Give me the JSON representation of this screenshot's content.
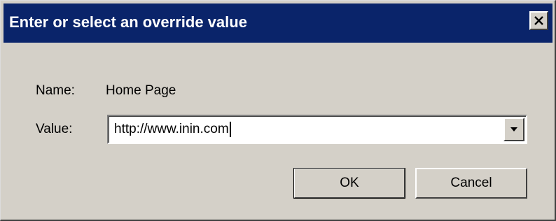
{
  "dialog": {
    "title": "Enter or select an override value",
    "close_icon": "close-x-icon"
  },
  "fields": {
    "name_label": "Name:",
    "name_value": "Home Page",
    "value_label": "Value:",
    "value_input": "http://www.inin.com",
    "dropdown_icon": "chevron-down-icon"
  },
  "buttons": {
    "ok_label": "OK",
    "cancel_label": "Cancel"
  },
  "colors": {
    "titlebar": "#0a246a",
    "dialog_bg": "#d4d0c8"
  }
}
